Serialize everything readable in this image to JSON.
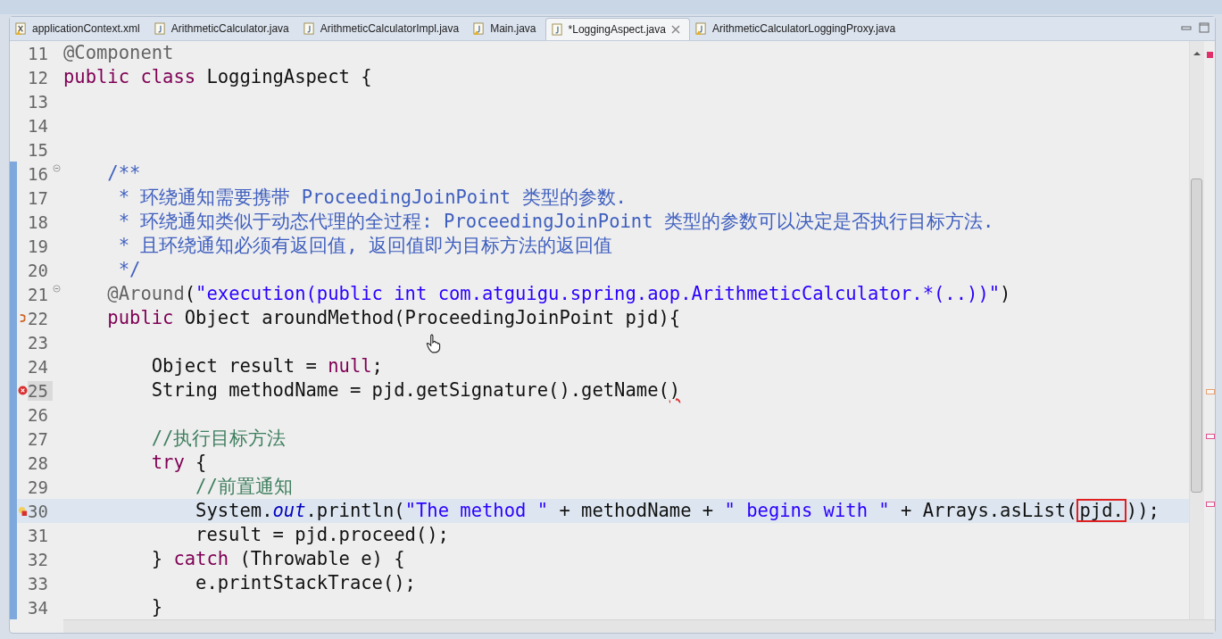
{
  "tabs": [
    {
      "label": "applicationContext.xml",
      "kind": "xml",
      "warning": true,
      "selected": false
    },
    {
      "label": "ArithmeticCalculator.java",
      "kind": "java",
      "warning": false,
      "selected": false
    },
    {
      "label": "ArithmeticCalculatorImpl.java",
      "kind": "java",
      "warning": false,
      "selected": false
    },
    {
      "label": "Main.java",
      "kind": "java",
      "warning": true,
      "selected": false
    },
    {
      "label": "*LoggingAspect.java",
      "kind": "java",
      "warning": false,
      "selected": true
    },
    {
      "label": "ArithmeticCalculatorLoggingProxy.java",
      "kind": "java",
      "warning": true,
      "selected": false
    }
  ],
  "lines": [
    {
      "number": "11",
      "kind": "top",
      "changed": false,
      "fold": false,
      "current": false,
      "tokens": [
        {
          "kind": "annotation",
          "gap": false,
          "text": "@Component"
        }
      ]
    },
    {
      "number": "12",
      "kind": "top",
      "changed": false,
      "fold": false,
      "current": false,
      "tokens": [
        {
          "kind": "keyword",
          "gap": false,
          "text": "public"
        },
        {
          "kind": "keyword",
          "gap": true,
          "text": "class"
        },
        {
          "kind": "plain",
          "gap": true,
          "text": "LoggingAspect {"
        }
      ]
    },
    {
      "number": "13",
      "changed": false,
      "fold": false,
      "current": false
    },
    {
      "number": "14",
      "changed": false,
      "fold": false,
      "current": false
    },
    {
      "number": "15",
      "changed": false,
      "fold": false,
      "current": false
    },
    {
      "number": "16",
      "kind": "member",
      "changed": true,
      "fold": true,
      "current": false,
      "tokens": [
        {
          "kind": "javadoc",
          "gap": false,
          "text": "/**"
        }
      ]
    },
    {
      "number": "17",
      "kind": "member",
      "changed": true,
      "fold": false,
      "current": false,
      "tokens": [
        {
          "kind": "javadoc",
          "gap": true,
          "text": "* 环绕通知需要携带 ProceedingJoinPoint 类型的参数."
        }
      ]
    },
    {
      "number": "18",
      "kind": "member",
      "changed": true,
      "fold": false,
      "current": false,
      "tokens": [
        {
          "kind": "javadoc",
          "gap": true,
          "text": "* 环绕通知类似于动态代理的全过程: ProceedingJoinPoint 类型的参数可以决定是否执行目标方法."
        }
      ]
    },
    {
      "number": "19",
      "kind": "member",
      "changed": true,
      "fold": false,
      "current": false,
      "tokens": [
        {
          "kind": "javadoc",
          "gap": true,
          "text": "* 且环绕通知必须有返回值, 返回值即为目标方法的返回值"
        }
      ]
    },
    {
      "number": "20",
      "kind": "member",
      "changed": true,
      "fold": false,
      "current": false,
      "tokens": [
        {
          "kind": "javadoc",
          "gap": true,
          "text": "*/"
        }
      ]
    },
    {
      "number": "21",
      "kind": "member",
      "changed": true,
      "fold": true,
      "current": false,
      "tokens": [
        {
          "kind": "annotation",
          "gap": false,
          "text": "@Around"
        },
        {
          "kind": "plain",
          "gap": false,
          "text": "("
        },
        {
          "kind": "string",
          "gap": false,
          "text": "\"execution(public int com.atguigu.spring.aop.ArithmeticCalculator.*(..))\""
        },
        {
          "kind": "plain",
          "gap": false,
          "text": ")"
        }
      ]
    },
    {
      "number": "22",
      "kind": "member",
      "changed": true,
      "fold": false,
      "current": false,
      "marker": {
        "kind": "override"
      },
      "tokens": [
        {
          "kind": "keyword",
          "gap": false,
          "text": "public"
        },
        {
          "kind": "plain",
          "gap": true,
          "text": "Object aroundMethod(ProceedingJoinPoint pjd){"
        }
      ]
    },
    {
      "number": "23",
      "changed": true,
      "fold": false,
      "current": false
    },
    {
      "number": "24",
      "kind": "body",
      "changed": true,
      "fold": false,
      "current": false,
      "tokens": [
        {
          "kind": "plain",
          "gap": false,
          "text": "Object result ="
        },
        {
          "kind": "keyword",
          "gap": true,
          "text": "null"
        },
        {
          "kind": "plain",
          "gap": false,
          "text": ";"
        }
      ]
    },
    {
      "number": "25",
      "kind": "body",
      "changed": true,
      "fold": false,
      "current": false,
      "marker": {
        "kind": "error"
      },
      "tokens": [
        {
          "kind": "plain",
          "gap": false,
          "text": "String methodName = pjd.getSignature().getName("
        },
        {
          "kind": "error",
          "gap": false,
          "text": ")"
        }
      ]
    },
    {
      "number": "26",
      "changed": true,
      "fold": false,
      "current": false
    },
    {
      "number": "27",
      "kind": "body",
      "changed": true,
      "fold": false,
      "current": false,
      "tokens": [
        {
          "kind": "comment",
          "gap": false,
          "text": "//执行目标方法"
        }
      ]
    },
    {
      "number": "28",
      "kind": "body",
      "changed": true,
      "fold": false,
      "current": false,
      "tokens": [
        {
          "kind": "keyword",
          "gap": false,
          "text": "try"
        },
        {
          "kind": "plain",
          "gap": true,
          "text": "{"
        }
      ]
    },
    {
      "number": "29",
      "kind": "nested",
      "changed": true,
      "fold": false,
      "current": false,
      "tokens": [
        {
          "kind": "comment",
          "gap": false,
          "text": "//前置通知"
        }
      ]
    },
    {
      "number": "30",
      "kind": "nested",
      "changed": true,
      "fold": false,
      "current": true,
      "marker": {
        "kind": "warning"
      },
      "tokens": [
        {
          "kind": "plain",
          "gap": false,
          "text": "System."
        },
        {
          "kind": "field",
          "gap": false,
          "text": "out"
        },
        {
          "kind": "plain",
          "gap": false,
          "text": ".println("
        },
        {
          "kind": "string",
          "gap": false,
          "text": "\"The method \""
        },
        {
          "kind": "plain",
          "gap": true,
          "text": "+ methodName +"
        },
        {
          "kind": "string",
          "gap": true,
          "text": "\" begins with \""
        },
        {
          "kind": "plain",
          "gap": true,
          "text": "+ Arrays.asList("
        },
        {
          "kind": "boxed",
          "gap": false,
          "text": "pjd."
        },
        {
          "kind": "plain",
          "gap": false,
          "text": "));"
        }
      ]
    },
    {
      "number": "31",
      "kind": "nested",
      "changed": true,
      "fold": false,
      "current": false,
      "tokens": [
        {
          "kind": "plain",
          "gap": false,
          "text": "result = pjd.proceed();"
        }
      ]
    },
    {
      "number": "32",
      "kind": "body",
      "changed": true,
      "fold": false,
      "current": false,
      "tokens": [
        {
          "kind": "plain",
          "gap": false,
          "text": "}"
        },
        {
          "kind": "keyword",
          "gap": true,
          "text": "catch"
        },
        {
          "kind": "plain",
          "gap": true,
          "text": "(Throwable e) {"
        }
      ]
    },
    {
      "number": "33",
      "kind": "nested",
      "changed": true,
      "fold": false,
      "current": false,
      "tokens": [
        {
          "kind": "plain",
          "gap": false,
          "text": "e.printStackTrace();"
        }
      ]
    },
    {
      "number": "34",
      "kind": "body",
      "changed": true,
      "fold": false,
      "current": false,
      "tokens": [
        {
          "kind": "plain",
          "gap": false,
          "text": "}"
        }
      ]
    }
  ],
  "overview_markers": [
    {
      "color": "#e8a070"
    },
    {
      "color": "#e05090"
    },
    {
      "color": "#e05090"
    }
  ]
}
